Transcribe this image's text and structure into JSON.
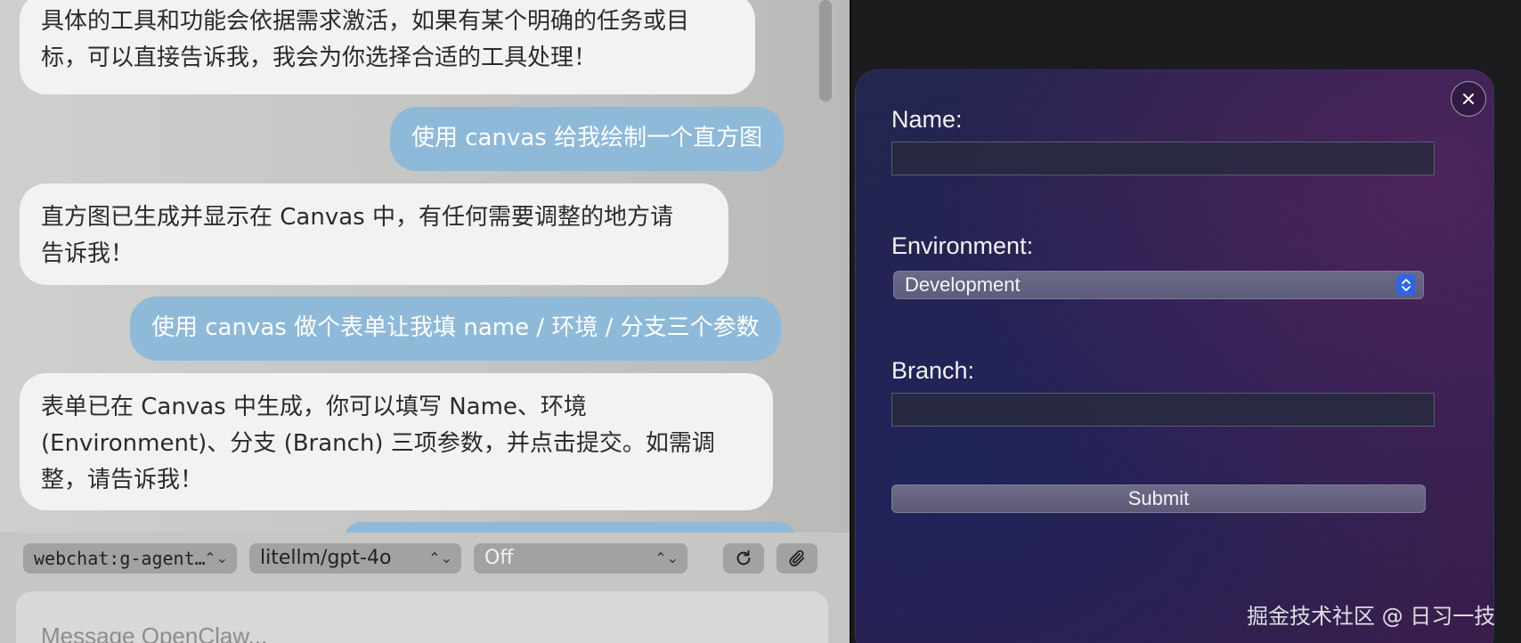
{
  "chat": {
    "messages": [
      {
        "role": "assistant",
        "lines": [
          "具体的工具和功能会依据需求激活，如果有某个明确的任务或目",
          "标，可以直接告诉我，我会为你选择合适的工具处理！"
        ]
      },
      {
        "role": "user",
        "lines": [
          "使用 canvas 给我绘制一个直方图"
        ]
      },
      {
        "role": "assistant",
        "lines": [
          "直方图已生成并显示在 Canvas 中，有任何需要调整的地方请",
          "告诉我！"
        ]
      },
      {
        "role": "user",
        "lines": [
          "使用 canvas 做个表单让我填 name / 环境 / 分支三个参数"
        ]
      },
      {
        "role": "assistant",
        "lines": [
          "表单已在 Canvas 中生成，你可以填写 Name、环境",
          "(Environment)、分支 (Branch) 三项参数，并点击提交。如需调",
          "整，请告诉我！"
        ]
      }
    ]
  },
  "controls": {
    "session": "webchat:g-agent…",
    "model": "litellm/gpt-4o",
    "thinking": "Off",
    "refresh_icon": "refresh-icon",
    "attach_icon": "paperclip-icon"
  },
  "composer": {
    "placeholder": "Message OpenClaw..."
  },
  "canvas_form": {
    "name_label": "Name:",
    "name_value": "",
    "environment_label": "Environment:",
    "environment_selected": "Development",
    "branch_label": "Branch:",
    "branch_value": "",
    "submit_label": "Submit",
    "close_icon": "close-icon"
  },
  "watermark": "掘金技术社区 @ 日习一技"
}
